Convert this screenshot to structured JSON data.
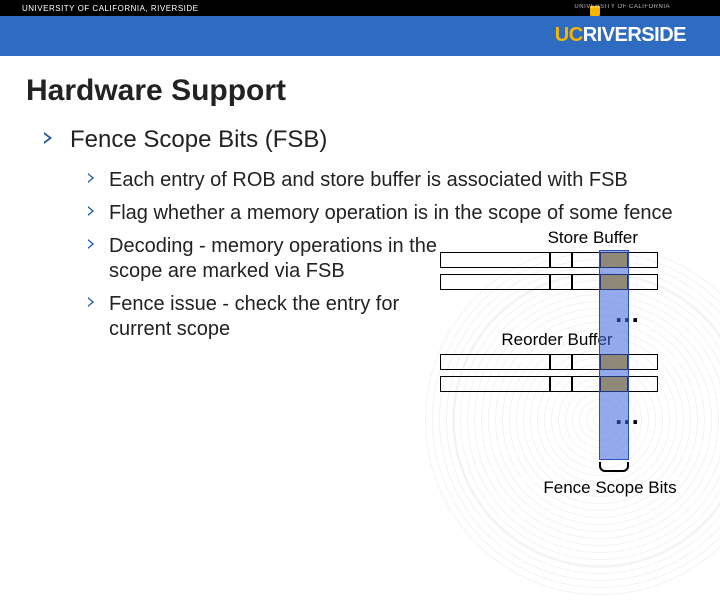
{
  "header": {
    "left_small": "UNIVERSITY OF CALIFORNIA, RIVERSIDE",
    "right_small": "UNIVERSITY OF CALIFORNIA",
    "logo_uc": "UC",
    "logo_riverside": "RIVERSIDE"
  },
  "title": "Hardware Support",
  "bullet_top": "Fence Scope Bits (FSB)",
  "subs": [
    "Each entry of ROB and store buffer is associated with FSB",
    "Flag whether a memory operation is in the scope of some fence",
    "Decoding - memory operations in the scope are marked via FSB",
    "Fence issue - check the entry for current scope"
  ],
  "diagram": {
    "label_store": "Store Buffer",
    "label_rob": "Reorder Buffer",
    "label_fsb": "Fence Scope Bits",
    "ellipsis": "…"
  }
}
